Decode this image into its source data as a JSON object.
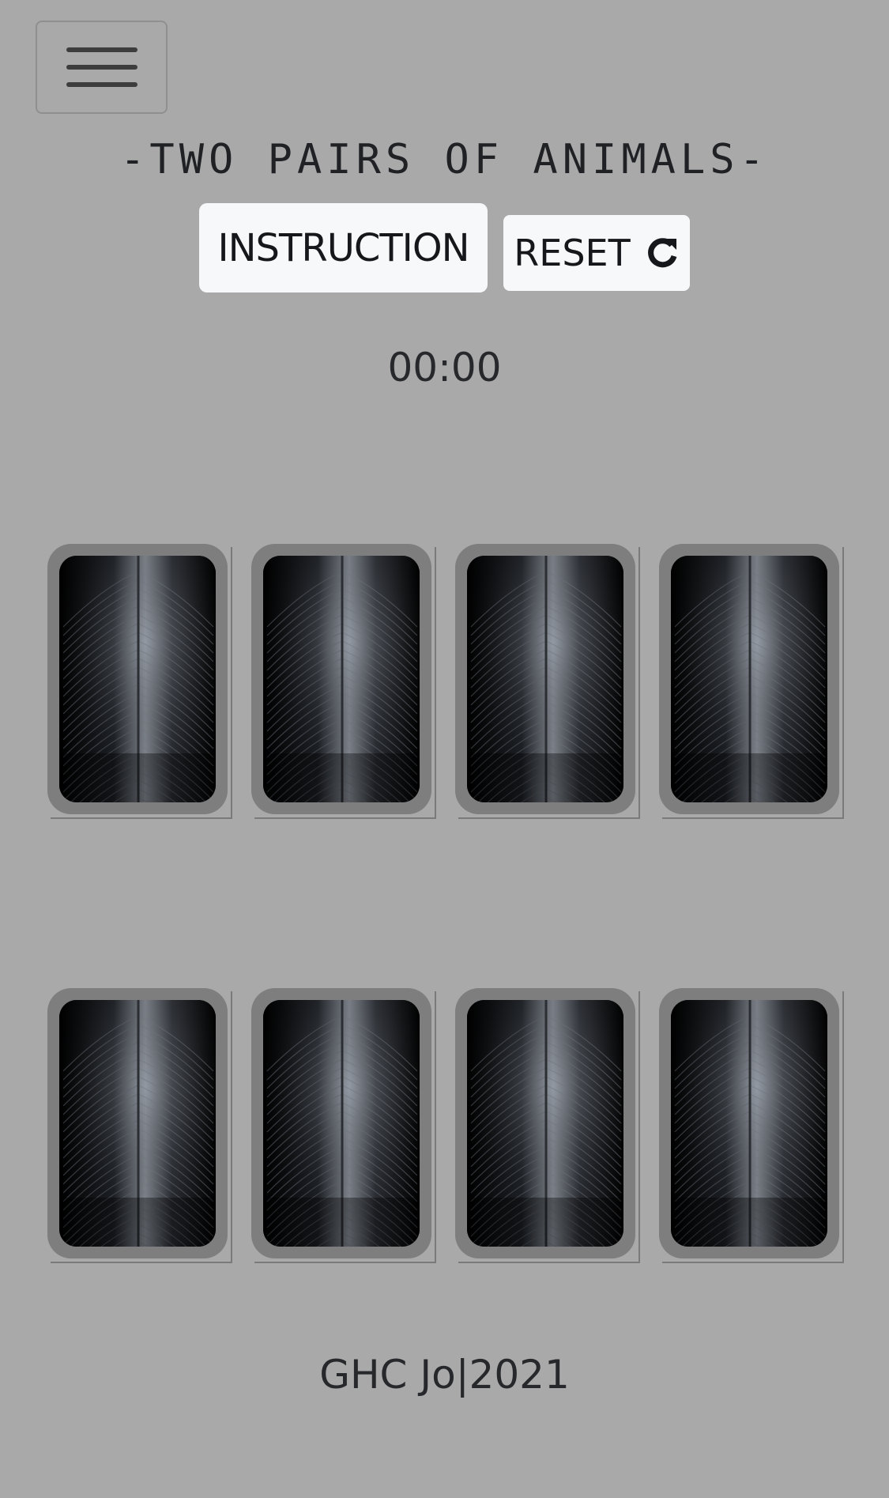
{
  "nav": {
    "menu_icon": "hamburger-menu-icon"
  },
  "header": {
    "title": "-TWO PAIRS OF ANIMALS-"
  },
  "controls": {
    "instruction_label": "INSTRUCTION",
    "reset_label": "RESET",
    "reset_icon": "refresh-icon"
  },
  "timer": {
    "value": "00:00"
  },
  "board": {
    "rows": 2,
    "columns": 4,
    "cards": [
      {
        "state": "face-down",
        "back_image": "feather-icon"
      },
      {
        "state": "face-down",
        "back_image": "feather-icon"
      },
      {
        "state": "face-down",
        "back_image": "feather-icon"
      },
      {
        "state": "face-down",
        "back_image": "feather-icon"
      },
      {
        "state": "face-down",
        "back_image": "feather-icon"
      },
      {
        "state": "face-down",
        "back_image": "feather-icon"
      },
      {
        "state": "face-down",
        "back_image": "feather-icon"
      },
      {
        "state": "face-down",
        "back_image": "feather-icon"
      }
    ]
  },
  "footer": {
    "text": "GHC Jo|2021"
  },
  "colors": {
    "background": "#a9a9a9",
    "button_bg": "#f7f8fa",
    "card_frame": "#7e7e7e"
  }
}
